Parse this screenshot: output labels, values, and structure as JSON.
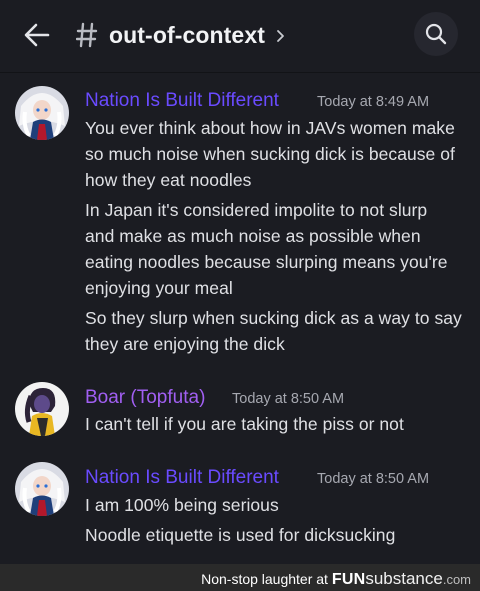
{
  "header": {
    "channel_name": "out-of-context",
    "icons": [
      "back-arrow-icon",
      "hash-icon",
      "chevron-right-icon",
      "search-icon"
    ]
  },
  "messages": [
    {
      "author": "Nation Is Built Different",
      "author_color": "#6a4bff",
      "timestamp": "Today at 8:49 AM",
      "lines": [
        "You ever think about how in JAVs women make",
        "so much noise when sucking dick is because of",
        "how they eat noodles",
        "In Japan it's considered impolite to not slurp",
        "and make as much noise as possible when",
        "eating noodles because slurping means you're",
        "enjoying your meal",
        "So they slurp when sucking dick as a way to say",
        "they are enjoying the dick"
      ]
    },
    {
      "author": "Boar (Topfuta)",
      "author_color": "#a15ff2",
      "timestamp": "Today at 8:50 AM",
      "lines": [
        "I can't tell if you are taking the piss or not"
      ]
    },
    {
      "author": "Nation Is Built Different",
      "author_color": "#6a4bff",
      "timestamp": "Today at 8:50 AM",
      "lines": [
        "I am 100% being serious",
        "Noodle etiquette is used for dicksucking"
      ]
    }
  ],
  "footer": {
    "prefix": "Non-stop laughter at",
    "brand_fun": "FUN",
    "brand_substance": "substance",
    "brand_com": ".com"
  }
}
